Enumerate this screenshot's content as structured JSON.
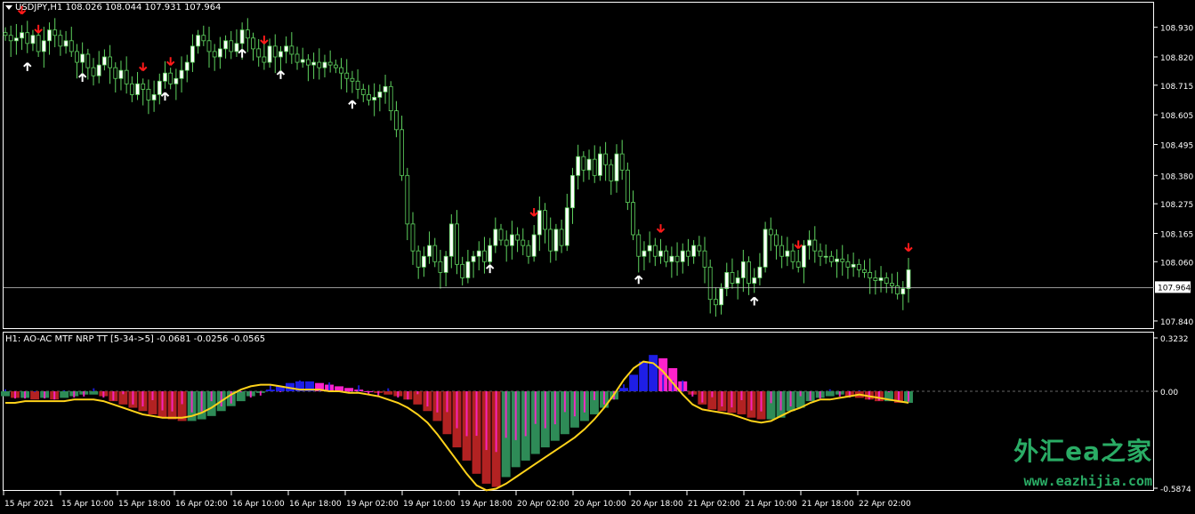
{
  "main_panel": {
    "header": "USDJPY,H1  108.026 108.044 107.931 107.964",
    "menu_icon": "triangle-down-icon",
    "price_labels": [
      "108.930",
      "108.820",
      "108.715",
      "108.605",
      "108.495",
      "108.380",
      "108.275",
      "108.165",
      "108.060",
      "107.840"
    ],
    "price_values": [
      108.93,
      108.82,
      108.715,
      108.605,
      108.495,
      108.38,
      108.275,
      108.165,
      108.06,
      107.84
    ],
    "current_price": "107.964",
    "current_price_value": 107.964,
    "colors": {
      "bull": "#ffffff",
      "bear": "#000000",
      "wick": "#5fd35f",
      "body_outline": "#5fd35f",
      "up_arrow": "#ffffff",
      "down_arrow": "#ff1a1a",
      "price_line": "#c8c8c8"
    }
  },
  "sub_panel": {
    "header": "H1: AO-AC MTF NRP TT [5-34->5] -0.0681 -0.0256 -0.0565",
    "scale_labels": [
      "0.3232",
      "0.00",
      "-0.5874"
    ],
    "scale_values": [
      0.3232,
      0.0,
      -0.5874
    ],
    "colors": {
      "green": "#2e8b57",
      "red": "#b22222",
      "blue": "#1e1ee6",
      "magenta": "#ff22cc",
      "signal": "#ffd21a"
    }
  },
  "time_axis": {
    "labels": [
      "15 Apr 2021",
      "15 Apr 10:00",
      "15 Apr 18:00",
      "16 Apr 02:00",
      "16 Apr 10:00",
      "16 Apr 18:00",
      "19 Apr 02:00",
      "19 Apr 10:00",
      "19 Apr 18:00",
      "20 Apr 02:00",
      "20 Apr 10:00",
      "20 Apr 18:00",
      "21 Apr 02:00",
      "21 Apr 10:00",
      "21 Apr 18:00",
      "22 Apr 02:00"
    ]
  },
  "watermark": {
    "main": "外汇ea之家",
    "sub": "www.eazhijia.com"
  },
  "chart_data": {
    "type": "candlestick",
    "symbol": "USDJPY",
    "timeframe": "H1",
    "closes": [
      108.9,
      108.88,
      108.89,
      108.91,
      108.87,
      108.9,
      108.84,
      108.88,
      108.92,
      108.9,
      108.86,
      108.88,
      108.84,
      108.8,
      108.83,
      108.78,
      108.75,
      108.79,
      108.82,
      108.78,
      108.74,
      108.77,
      108.72,
      108.68,
      108.72,
      108.7,
      108.66,
      108.68,
      108.73,
      108.76,
      108.72,
      108.74,
      108.77,
      108.8,
      108.86,
      108.9,
      108.88,
      108.84,
      108.82,
      108.85,
      108.88,
      108.84,
      108.87,
      108.92,
      108.89,
      108.85,
      108.82,
      108.8,
      108.86,
      108.82,
      108.84,
      108.86,
      108.83,
      108.8,
      108.81,
      108.79,
      108.8,
      108.78,
      108.8,
      108.79,
      108.78,
      108.76,
      108.74,
      108.73,
      108.7,
      108.68,
      108.66,
      108.67,
      108.69,
      108.71,
      108.62,
      108.55,
      108.38,
      108.2,
      108.1,
      108.04,
      108.08,
      108.12,
      108.06,
      108.02,
      108.08,
      108.2,
      108.05,
      108.0,
      108.06,
      108.08,
      108.1,
      108.06,
      108.12,
      108.18,
      108.14,
      108.12,
      108.16,
      108.14,
      108.12,
      108.08,
      108.16,
      108.25,
      108.18,
      108.1,
      108.18,
      108.12,
      108.26,
      108.38,
      108.45,
      108.4,
      108.44,
      108.38,
      108.46,
      108.42,
      108.36,
      108.46,
      108.4,
      108.28,
      108.16,
      108.08,
      108.1,
      108.12,
      108.08,
      108.1,
      108.06,
      108.08,
      108.06,
      108.1,
      108.08,
      108.12,
      108.1,
      108.04,
      107.92,
      107.9,
      107.96,
      108.02,
      107.98,
      108.0,
      108.06,
      107.98,
      108.0,
      108.04,
      108.18,
      108.16,
      108.12,
      108.08,
      108.1,
      108.06,
      108.04,
      108.12,
      108.14,
      108.1,
      108.08,
      108.08,
      108.06,
      108.07,
      108.06,
      108.04,
      108.05,
      108.03,
      108.02,
      108.0,
      107.99,
      108.0,
      107.98,
      107.97,
      107.94,
      107.96,
      108.03
    ],
    "up_arrow_bars": [
      11,
      40,
      80,
      120,
      140,
      178,
      248,
      322,
      382
    ],
    "down_arrow_bars": [
      8,
      18,
      70,
      85,
      133,
      269,
      333,
      404,
      459
    ],
    "oscillator_values": [
      -0.03,
      -0.04,
      -0.04,
      -0.05,
      -0.04,
      -0.05,
      -0.04,
      -0.03,
      -0.02,
      -0.02,
      -0.03,
      -0.06,
      -0.08,
      -0.1,
      -0.12,
      -0.14,
      -0.16,
      -0.17,
      -0.18,
      -0.18,
      -0.17,
      -0.15,
      -0.12,
      -0.09,
      -0.06,
      -0.03,
      -0.01,
      0.01,
      0.03,
      0.05,
      0.06,
      0.06,
      0.05,
      0.04,
      0.03,
      0.02,
      0.01,
      0.0,
      -0.01,
      -0.02,
      -0.03,
      -0.05,
      -0.08,
      -0.12,
      -0.18,
      -0.26,
      -0.34,
      -0.42,
      -0.5,
      -0.56,
      -0.58,
      -0.52,
      -0.46,
      -0.42,
      -0.38,
      -0.34,
      -0.3,
      -0.26,
      -0.22,
      -0.18,
      -0.14,
      -0.1,
      -0.05,
      0.02,
      0.1,
      0.18,
      0.22,
      0.2,
      0.14,
      0.06,
      -0.02,
      -0.08,
      -0.11,
      -0.12,
      -0.13,
      -0.14,
      -0.16,
      -0.17,
      -0.17,
      -0.16,
      -0.12,
      -0.1,
      -0.06,
      -0.04,
      -0.03,
      -0.02,
      -0.03,
      -0.04,
      -0.05,
      -0.06,
      -0.06,
      -0.07,
      -0.07
    ],
    "signal_values": [
      -0.07,
      -0.07,
      -0.06,
      -0.06,
      -0.06,
      -0.06,
      -0.06,
      -0.05,
      -0.05,
      -0.05,
      -0.06,
      -0.08,
      -0.1,
      -0.12,
      -0.14,
      -0.15,
      -0.16,
      -0.16,
      -0.16,
      -0.15,
      -0.13,
      -0.1,
      -0.06,
      -0.02,
      0.01,
      0.03,
      0.04,
      0.04,
      0.03,
      0.02,
      0.01,
      0.01,
      0.01,
      0.0,
      0.0,
      -0.01,
      -0.01,
      -0.02,
      -0.03,
      -0.05,
      -0.07,
      -0.1,
      -0.14,
      -0.19,
      -0.26,
      -0.34,
      -0.42,
      -0.5,
      -0.57,
      -0.6,
      -0.59,
      -0.56,
      -0.52,
      -0.48,
      -0.44,
      -0.4,
      -0.36,
      -0.32,
      -0.28,
      -0.23,
      -0.17,
      -0.1,
      -0.02,
      0.07,
      0.14,
      0.18,
      0.17,
      0.12,
      0.05,
      -0.02,
      -0.08,
      -0.11,
      -0.12,
      -0.13,
      -0.14,
      -0.16,
      -0.18,
      -0.19,
      -0.18,
      -0.15,
      -0.12,
      -0.1,
      -0.07,
      -0.05,
      -0.05,
      -0.04,
      -0.03,
      -0.02,
      -0.03,
      -0.04,
      -0.05,
      -0.06,
      -0.07
    ]
  }
}
